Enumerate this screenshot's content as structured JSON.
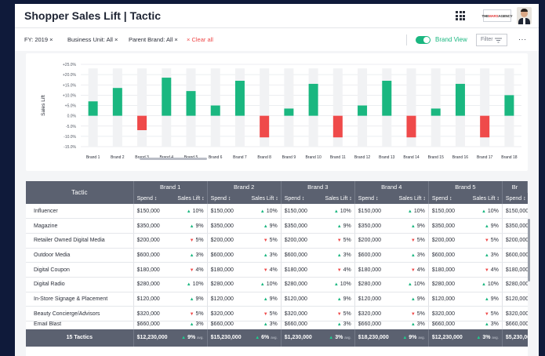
{
  "header": {
    "title": "Shopper Sales Lift  |  Tactic",
    "logo_text": "THEMARSAGENCY",
    "logo_prefix": "THE",
    "logo_accent": "MARS",
    "logo_suffix": "AGENCY"
  },
  "filters": {
    "chips": [
      {
        "label": "FY: 2019",
        "remove": "×"
      },
      {
        "label": "Business Unit: All",
        "remove": "×"
      },
      {
        "label": "Parent Brand: All",
        "remove": "×"
      }
    ],
    "clear_label": "× Clear all",
    "brand_view_label": "Brand View",
    "brand_view_on": true,
    "filter_label": "Filter",
    "more_label": "···"
  },
  "colors": {
    "positive": "#1ab780",
    "negative": "#ef4a4a",
    "header_bg": "#5b6170",
    "accent": "#1ab780"
  },
  "chart_data": {
    "type": "bar",
    "ylabel": "Sales Lift",
    "ylim": [
      -15,
      25
    ],
    "y_ticks": [
      "+25.0%",
      "+20.0%",
      "+15.0%",
      "+10.0%",
      "+5.0%",
      "0.0%",
      "-5.0%",
      "-10.0%",
      "-15.0%"
    ],
    "y_tick_values": [
      25,
      20,
      15,
      10,
      5,
      0,
      -5,
      -10,
      -15
    ],
    "categories": [
      "Brand 1",
      "Brand 2",
      "Brand 3",
      "Brand 4",
      "Brand 5",
      "Brand 6",
      "Brand 7",
      "Brand 8",
      "Brand 9",
      "Brand 10",
      "Brand 11",
      "Brand 12",
      "Brand 13",
      "Brand 14",
      "Brand 15",
      "Brand 16",
      "Brand 17",
      "Brand 18"
    ],
    "values": [
      7,
      13.5,
      -7,
      18.5,
      12,
      5,
      17,
      -10.5,
      3.5,
      15.5,
      -10.5,
      5,
      17,
      -10.5,
      3.5,
      15.5,
      -10.5,
      10
    ],
    "grid": true,
    "background_bars": true
  },
  "table": {
    "tactic_header": "Tactic",
    "brands": [
      "Brand 1",
      "Brand 2",
      "Brand 3",
      "Brand 4",
      "Brand 5",
      "Br"
    ],
    "spend_label": "Spend ↕",
    "lift_label": "Sales Lift ↕",
    "rows": [
      {
        "tactic": "Influencer",
        "spend": "$150,000",
        "dir": "up",
        "lift": "10%"
      },
      {
        "tactic": "Magazine",
        "spend": "$350,000",
        "dir": "up",
        "lift": "9%"
      },
      {
        "tactic": "Retailer Owned Digital Media",
        "spend": "$200,000",
        "dir": "down",
        "lift": "5%"
      },
      {
        "tactic": "Outdoor Media",
        "spend": "$600,000",
        "dir": "up",
        "lift": "3%"
      },
      {
        "tactic": "Digital Coupon",
        "spend": "$180,000",
        "dir": "down",
        "lift": "4%"
      },
      {
        "tactic": "Digital Radio",
        "spend": "$280,000",
        "dir": "up",
        "lift": "10%"
      },
      {
        "tactic": "In-Store Signage & Placement",
        "spend": "$120,000",
        "dir": "up",
        "lift": "9%"
      },
      {
        "tactic": "Beauty Concierge/Advisors",
        "spend": "$320,000",
        "dir": "down",
        "lift": "5%"
      },
      {
        "tactic": "Email Blast",
        "spend": "$660,000",
        "dir": "up",
        "lift": "3%"
      }
    ],
    "footer": {
      "label": "15 Tactics",
      "avg_label": "avg.",
      "cols": [
        {
          "spend": "$12,230,000",
          "lift": "9%"
        },
        {
          "spend": "$15,230,000",
          "lift": "6%"
        },
        {
          "spend": "$1,230,000",
          "lift": "3%"
        },
        {
          "spend": "$18,230,000",
          "lift": "9%"
        },
        {
          "spend": "$12,230,000",
          "lift": "3%"
        },
        {
          "spend": "$5,230,00",
          "lift": ""
        }
      ]
    }
  }
}
